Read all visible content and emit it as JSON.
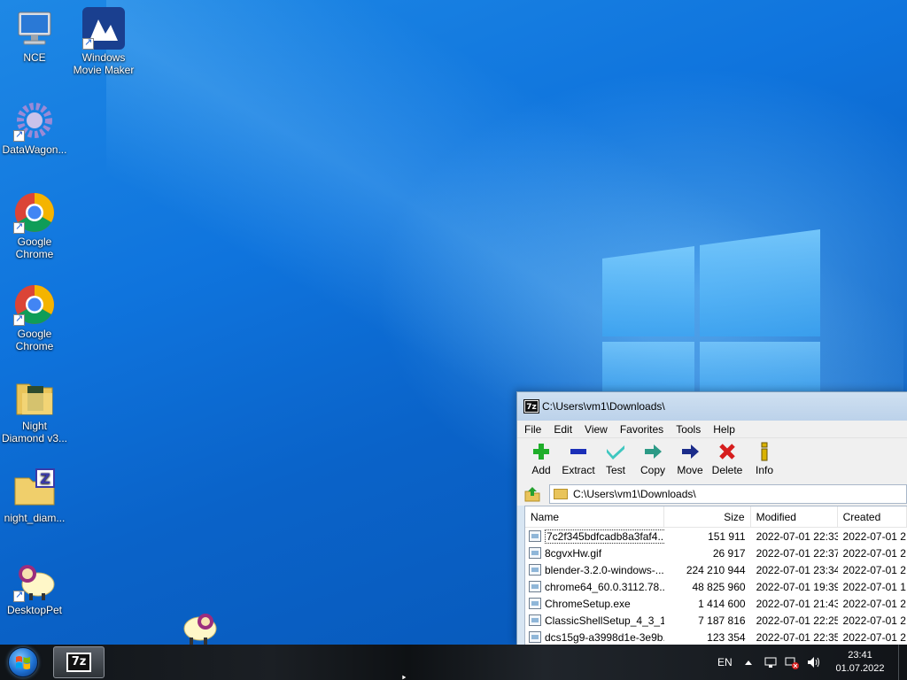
{
  "desktop": {
    "icons": [
      {
        "name": "nce",
        "label": "NCE",
        "icon": "computer-monitor-icon"
      },
      {
        "name": "windows-movie-maker",
        "label": "Windows\nMovie Maker",
        "icon": "movie-maker-icon"
      },
      {
        "name": "datawagon",
        "label": "DataWagon...",
        "icon": "gear-icon"
      },
      {
        "name": "google-chrome-1",
        "label": "Google\nChrome",
        "icon": "chrome-icon"
      },
      {
        "name": "google-chrome-2",
        "label": "Google\nChrome",
        "icon": "chrome-icon"
      },
      {
        "name": "night-diamond",
        "label": "Night\nDiamond v3...",
        "icon": "folder-icon"
      },
      {
        "name": "night-diam-zip",
        "label": "night_diam...",
        "icon": "zip-folder-icon"
      },
      {
        "name": "desktoppet",
        "label": "DesktopPet",
        "icon": "sheep-icon"
      }
    ]
  },
  "file_manager": {
    "title": "C:\\Users\\vm1\\Downloads\\",
    "app_icon_text": "7z",
    "menu": [
      "File",
      "Edit",
      "View",
      "Favorites",
      "Tools",
      "Help"
    ],
    "toolbar": [
      {
        "name": "add",
        "label": "Add",
        "color": "#1fae2a"
      },
      {
        "name": "extract",
        "label": "Extract",
        "color": "#1b2fb8"
      },
      {
        "name": "test",
        "label": "Test",
        "color": "#3fc7c0"
      },
      {
        "name": "copy",
        "label": "Copy",
        "color": "#2c9a86"
      },
      {
        "name": "move",
        "label": "Move",
        "color": "#1b2c8a"
      },
      {
        "name": "delete",
        "label": "Delete",
        "color": "#d61d1d"
      },
      {
        "name": "info",
        "label": "Info",
        "color": "#d9b200"
      }
    ],
    "address": "C:\\Users\\vm1\\Downloads\\",
    "columns": {
      "name": "Name",
      "size": "Size",
      "modified": "Modified",
      "created": "Created"
    },
    "files": [
      {
        "name": "7c2f345bdfcadb8a3faf4...",
        "size": "151 911",
        "modified": "2022-07-01 22:33",
        "created": "2022-07-01 2",
        "icon": "image-file-icon"
      },
      {
        "name": "8cgvxHw.gif",
        "size": "26 917",
        "modified": "2022-07-01 22:37",
        "created": "2022-07-01 2",
        "icon": "gif-file-icon"
      },
      {
        "name": "blender-3.2.0-windows-...",
        "size": "224 210 944",
        "modified": "2022-07-01 23:34",
        "created": "2022-07-01 2",
        "icon": "installer-file-icon"
      },
      {
        "name": "chrome64_60.0.3112.78....",
        "size": "48 825 960",
        "modified": "2022-07-01 19:39",
        "created": "2022-07-01 1",
        "icon": "exe-file-icon"
      },
      {
        "name": "ChromeSetup.exe",
        "size": "1 414 600",
        "modified": "2022-07-01 21:43",
        "created": "2022-07-01 2",
        "icon": "exe-file-icon"
      },
      {
        "name": "ClassicShellSetup_4_3_1....",
        "size": "7 187 816",
        "modified": "2022-07-01 22:25",
        "created": "2022-07-01 2",
        "icon": "exe-file-icon"
      },
      {
        "name": "dcs15g9-a3998d1e-3e9b...",
        "size": "123 354",
        "modified": "2022-07-01 22:35",
        "created": "2022-07-01 2",
        "icon": "image-file-icon"
      }
    ]
  },
  "taskbar": {
    "app_label": "7z",
    "language": "EN",
    "time": "23:41",
    "date": "01.07.2022"
  }
}
